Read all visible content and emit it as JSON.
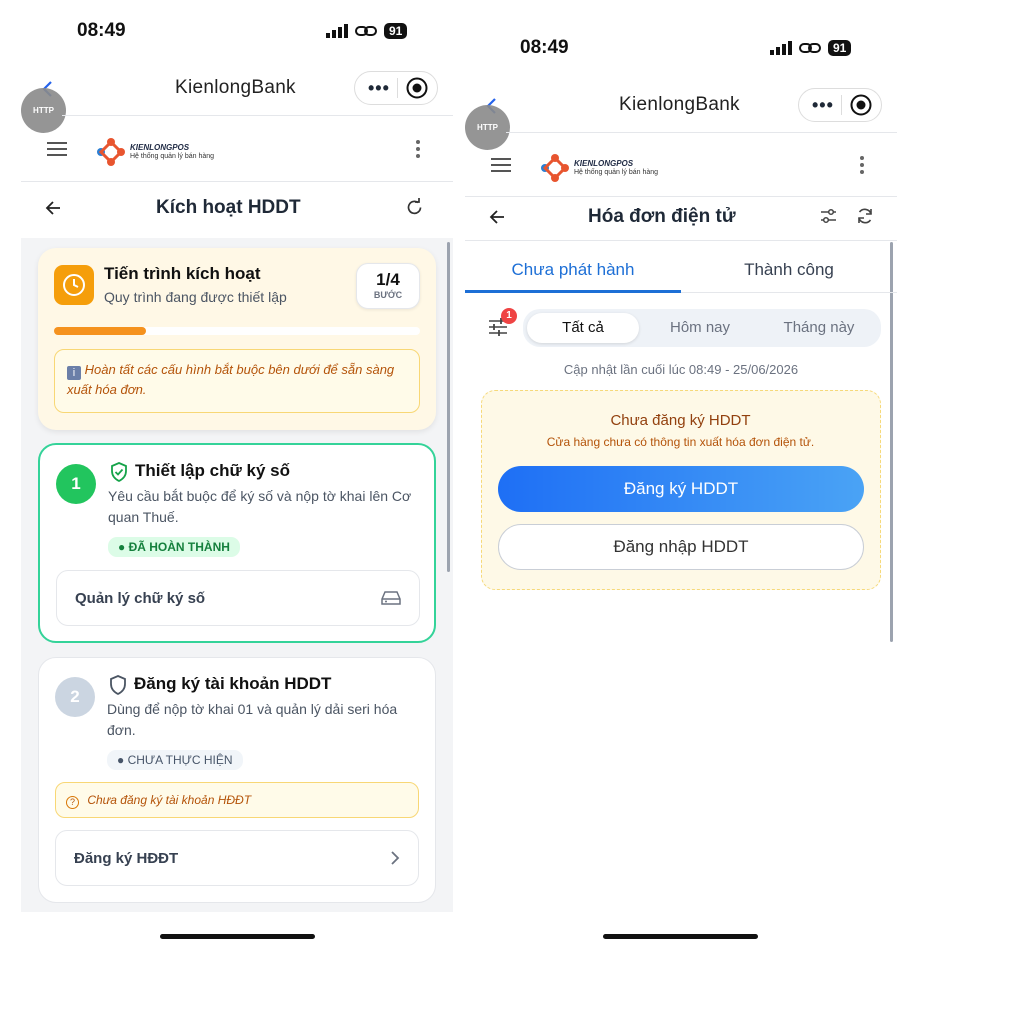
{
  "left": {
    "status_bar": {
      "time": "08:49",
      "battery": "91"
    },
    "miniapp": {
      "title": "KienlongBank",
      "back_icon": "chevron-left-icon",
      "http_badge": "HTTP"
    },
    "brand": {
      "name": "KIENLONGPOS",
      "subtitle": "Hệ thống quản lý bán hàng"
    },
    "header": {
      "title": "Kích hoạt HDDT"
    },
    "progress": {
      "title": "Tiến trình kích hoạt",
      "subtitle": "Quy trình đang được thiết lập",
      "step_count": "1/4",
      "step_label": "BƯỚC",
      "fraction": 0.25,
      "note": "Hoàn tất các cấu hình bắt buộc bên dưới để sẵn sàng xuất hóa đơn."
    },
    "steps": [
      {
        "number": "1",
        "title": "Thiết lập chữ ký số",
        "desc": "Yêu cầu bắt buộc để ký số và nộp tờ khai lên Cơ quan Thuế.",
        "status": "ĐÃ HOÀN THÀNH",
        "action": "Quản lý chữ ký số"
      },
      {
        "number": "2",
        "title": "Đăng ký tài khoản HDDT",
        "desc": "Dùng để nộp tờ khai 01 và quản lý dải seri hóa đơn.",
        "status": "CHƯA THỰC HIỆN",
        "warning": "Chưa đăng ký tài khoản HĐĐT",
        "action": "Đăng ký HĐĐT"
      }
    ]
  },
  "right": {
    "status_bar": {
      "time": "08:49",
      "battery": "91"
    },
    "miniapp": {
      "title": "KienlongBank",
      "http_badge": "HTTP"
    },
    "brand": {
      "name": "KIENLONGPOS",
      "subtitle": "Hệ thống quản lý bán hàng"
    },
    "header": {
      "title": "Hóa đơn điện tử"
    },
    "tabs": [
      "Chưa phát hành",
      "Thành công"
    ],
    "filter_badge": "1",
    "segments": [
      "Tất cả",
      "Hôm nay",
      "Tháng này"
    ],
    "last_updated": "Cập nhật lần cuối lúc 08:49 - 25/06/2026",
    "empty": {
      "title": "Chưa đăng ký HDDT",
      "desc": "Cửa hàng chưa có thông tin xuất hóa đơn điện tử.",
      "primary": "Đăng ký HDDT",
      "secondary": "Đăng nhập HDDT"
    }
  },
  "colors": {
    "accent_blue": "#1e6ff5",
    "orange": "#f5921e",
    "green": "#22c55e"
  }
}
